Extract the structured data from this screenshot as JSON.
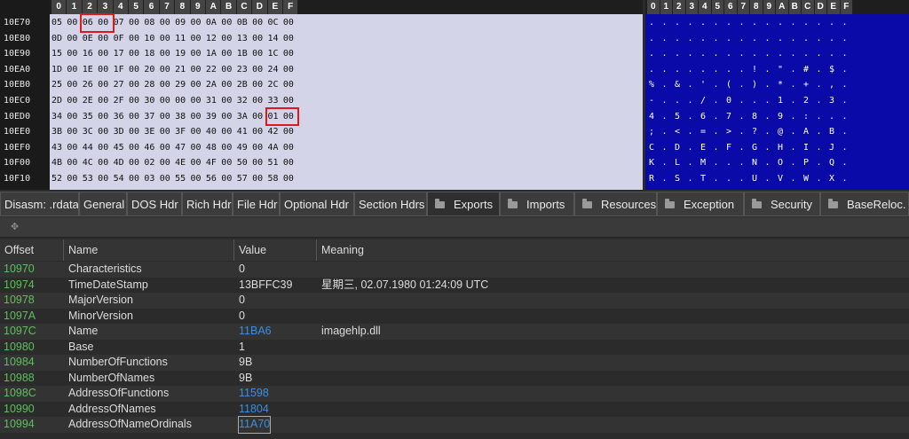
{
  "hex": {
    "col_headers": [
      "0",
      "1",
      "2",
      "3",
      "4",
      "5",
      "6",
      "7",
      "8",
      "9",
      "A",
      "B",
      "C",
      "D",
      "E",
      "F"
    ],
    "rows": [
      {
        "addr": "10E70",
        "bytes": [
          "05",
          "00",
          "06",
          "00",
          "07",
          "00",
          "08",
          "00",
          "09",
          "00",
          "0A",
          "00",
          "0B",
          "00",
          "0C",
          "00"
        ],
        "ascii": [
          ".",
          ".",
          ".",
          ".",
          ".",
          ".",
          ".",
          ".",
          ".",
          ".",
          ".",
          ".",
          ".",
          ".",
          ".",
          "."
        ]
      },
      {
        "addr": "10E80",
        "bytes": [
          "0D",
          "00",
          "0E",
          "00",
          "0F",
          "00",
          "10",
          "00",
          "11",
          "00",
          "12",
          "00",
          "13",
          "00",
          "14",
          "00"
        ],
        "ascii": [
          ".",
          ".",
          ".",
          ".",
          ".",
          ".",
          ".",
          ".",
          ".",
          ".",
          ".",
          ".",
          ".",
          ".",
          ".",
          "."
        ]
      },
      {
        "addr": "10E90",
        "bytes": [
          "15",
          "00",
          "16",
          "00",
          "17",
          "00",
          "18",
          "00",
          "19",
          "00",
          "1A",
          "00",
          "1B",
          "00",
          "1C",
          "00"
        ],
        "ascii": [
          ".",
          ".",
          ".",
          ".",
          ".",
          ".",
          ".",
          ".",
          ".",
          ".",
          ".",
          ".",
          ".",
          ".",
          ".",
          "."
        ]
      },
      {
        "addr": "10EA0",
        "bytes": [
          "1D",
          "00",
          "1E",
          "00",
          "1F",
          "00",
          "20",
          "00",
          "21",
          "00",
          "22",
          "00",
          "23",
          "00",
          "24",
          "00"
        ],
        "ascii": [
          ".",
          ".",
          ".",
          ".",
          ".",
          ".",
          ".",
          ".",
          "!",
          ".",
          "\"",
          ".",
          "#",
          ".",
          "$",
          "."
        ]
      },
      {
        "addr": "10EB0",
        "bytes": [
          "25",
          "00",
          "26",
          "00",
          "27",
          "00",
          "28",
          "00",
          "29",
          "00",
          "2A",
          "00",
          "2B",
          "00",
          "2C",
          "00"
        ],
        "ascii": [
          "%",
          ".",
          "&",
          ".",
          "'",
          ".",
          "(",
          ".",
          ")",
          ".",
          "*",
          ".",
          "+",
          ".",
          ",",
          "."
        ]
      },
      {
        "addr": "10EC0",
        "bytes": [
          "2D",
          "00",
          "2E",
          "00",
          "2F",
          "00",
          "30",
          "00",
          "00",
          "00",
          "31",
          "00",
          "32",
          "00",
          "33",
          "00"
        ],
        "ascii": [
          "-",
          ".",
          ".",
          ".",
          "/",
          ".",
          "0",
          ".",
          ".",
          ".",
          "1",
          ".",
          "2",
          ".",
          "3",
          "."
        ]
      },
      {
        "addr": "10ED0",
        "bytes": [
          "34",
          "00",
          "35",
          "00",
          "36",
          "00",
          "37",
          "00",
          "38",
          "00",
          "39",
          "00",
          "3A",
          "00",
          "01",
          "00"
        ],
        "ascii": [
          "4",
          ".",
          "5",
          ".",
          "6",
          ".",
          "7",
          ".",
          "8",
          ".",
          "9",
          ".",
          ":",
          ".",
          ".",
          "."
        ]
      },
      {
        "addr": "10EE0",
        "bytes": [
          "3B",
          "00",
          "3C",
          "00",
          "3D",
          "00",
          "3E",
          "00",
          "3F",
          "00",
          "40",
          "00",
          "41",
          "00",
          "42",
          "00"
        ],
        "ascii": [
          ";",
          ".",
          "<",
          ".",
          "=",
          ".",
          ">",
          ".",
          "?",
          ".",
          "@",
          ".",
          "A",
          ".",
          "B",
          "."
        ]
      },
      {
        "addr": "10EF0",
        "bytes": [
          "43",
          "00",
          "44",
          "00",
          "45",
          "00",
          "46",
          "00",
          "47",
          "00",
          "48",
          "00",
          "49",
          "00",
          "4A",
          "00"
        ],
        "ascii": [
          "C",
          ".",
          "D",
          ".",
          "E",
          ".",
          "F",
          ".",
          "G",
          ".",
          "H",
          ".",
          "I",
          ".",
          "J",
          "."
        ]
      },
      {
        "addr": "10F00",
        "bytes": [
          "4B",
          "00",
          "4C",
          "00",
          "4D",
          "00",
          "02",
          "00",
          "4E",
          "00",
          "4F",
          "00",
          "50",
          "00",
          "51",
          "00"
        ],
        "ascii": [
          "K",
          ".",
          "L",
          ".",
          "M",
          ".",
          ".",
          ".",
          "N",
          ".",
          "O",
          ".",
          "P",
          ".",
          "Q",
          "."
        ]
      },
      {
        "addr": "10F10",
        "bytes": [
          "52",
          "00",
          "53",
          "00",
          "54",
          "00",
          "03",
          "00",
          "55",
          "00",
          "56",
          "00",
          "57",
          "00",
          "58",
          "00"
        ],
        "ascii": [
          "R",
          ".",
          "S",
          ".",
          "T",
          ".",
          ".",
          ".",
          "U",
          ".",
          "V",
          ".",
          "W",
          ".",
          "X",
          "."
        ]
      }
    ],
    "highlight_color": "#e01818"
  },
  "tabs": [
    {
      "label": "Disasm: .rdata",
      "folder": false
    },
    {
      "label": "General",
      "folder": false
    },
    {
      "label": "DOS Hdr",
      "folder": false
    },
    {
      "label": "Rich Hdr",
      "folder": false
    },
    {
      "label": "File Hdr",
      "folder": false
    },
    {
      "label": "Optional Hdr",
      "folder": false
    },
    {
      "label": "Section Hdrs",
      "folder": false
    },
    {
      "label": "Exports",
      "folder": true,
      "active": true
    },
    {
      "label": "Imports",
      "folder": true
    },
    {
      "label": "Resources",
      "folder": true
    },
    {
      "label": "Exception",
      "folder": true
    },
    {
      "label": "Security",
      "folder": true
    },
    {
      "label": "BaseReloc.",
      "folder": true
    }
  ],
  "toolbar": {
    "icon": "move-icon"
  },
  "table": {
    "headers": {
      "offset": "Offset",
      "name": "Name",
      "value": "Value",
      "meaning": "Meaning"
    },
    "rows": [
      {
        "offset": "10970",
        "name": "Characteristics",
        "value": "0",
        "meaning": ""
      },
      {
        "offset": "10974",
        "name": "TimeDateStamp",
        "value": "13BFFC39",
        "meaning": "星期三, 02.07.1980 01:24:09 UTC"
      },
      {
        "offset": "10978",
        "name": "MajorVersion",
        "value": "0",
        "meaning": ""
      },
      {
        "offset": "1097A",
        "name": "MinorVersion",
        "value": "0",
        "meaning": ""
      },
      {
        "offset": "1097C",
        "name": "Name",
        "value": "11BA6",
        "meaning": "imagehlp.dll",
        "link": true
      },
      {
        "offset": "10980",
        "name": "Base",
        "value": "1",
        "meaning": ""
      },
      {
        "offset": "10984",
        "name": "NumberOfFunctions",
        "value": "9B",
        "meaning": ""
      },
      {
        "offset": "10988",
        "name": "NumberOfNames",
        "value": "9B",
        "meaning": ""
      },
      {
        "offset": "1098C",
        "name": "AddressOfFunctions",
        "value": "11598",
        "meaning": "",
        "link": true
      },
      {
        "offset": "10990",
        "name": "AddressOfNames",
        "value": "11804",
        "meaning": "",
        "link": true
      },
      {
        "offset": "10994",
        "name": "AddressOfNameOrdinals",
        "value": "11A70",
        "meaning": "",
        "link": true,
        "selected": true
      }
    ]
  },
  "colors": {
    "offset_green": "#5fbf5f",
    "link_blue": "#3c8fe0",
    "ascii_bg": "#0a0aa8",
    "hex_bg": "#d4d4e8"
  }
}
